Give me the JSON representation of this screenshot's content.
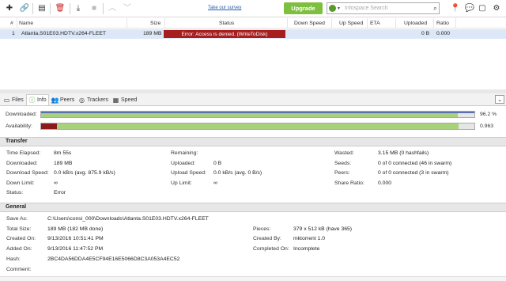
{
  "toolbar": {
    "icons": [
      "add-torrent-icon",
      "add-link-icon",
      "create-torrent-icon",
      "remove-icon",
      "download-icon",
      "stop-icon",
      "move-up-icon",
      "move-down-icon"
    ],
    "survey_label": "Take our survey",
    "upgrade_label": "Upgrade",
    "search_placeholder": "Infospace Search",
    "right_icons": [
      "location-icon",
      "chat-icon",
      "monitor-icon",
      "settings-icon"
    ]
  },
  "columns": {
    "num": "#",
    "name": "Name",
    "size": "Size",
    "status": "Status",
    "down_speed": "Down Speed",
    "up_speed": "Up Speed",
    "eta": "ETA",
    "uploaded": "Uploaded",
    "ratio": "Ratio"
  },
  "torrents": [
    {
      "num": "1",
      "name": "Atlanta.S01E03.HDTV.x264-FLEET",
      "size": "189 MB",
      "status": "Error: Access is denied. (WriteToDisk)",
      "down_speed": "",
      "up_speed": "",
      "eta": "",
      "uploaded": "0 B",
      "ratio": "0.000"
    }
  ],
  "tabs": [
    {
      "label": "Files",
      "icon": "files-icon"
    },
    {
      "label": "Info",
      "icon": "info-icon"
    },
    {
      "label": "Peers",
      "icon": "peers-icon"
    },
    {
      "label": "Trackers",
      "icon": "trackers-icon"
    },
    {
      "label": "Speed",
      "icon": "speed-icon"
    }
  ],
  "downloaded": {
    "label": "Downloaded:",
    "value": "96.2 %",
    "fraction": 0.962
  },
  "availability": {
    "label": "Availability:",
    "value": "0.963",
    "fraction": 0.963
  },
  "transfer": {
    "title": "Transfer",
    "col1": [
      {
        "label": "Time Elapsed:",
        "value": "8m 55s"
      },
      {
        "label": "Downloaded:",
        "value": "189 MB"
      },
      {
        "label": "Download Speed:",
        "value": "0.0 kB/s (avg. 875.9 kB/s)"
      },
      {
        "label": "Down Limit:",
        "value": "∞"
      },
      {
        "label": "Status:",
        "value": "Error"
      }
    ],
    "col2": [
      {
        "label": "Remaining:",
        "value": ""
      },
      {
        "label": "Uploaded:",
        "value": "0 B"
      },
      {
        "label": "Upload Speed:",
        "value": "0.0 kB/s (avg. 0 B/s)"
      },
      {
        "label": "Up Limit:",
        "value": "∞"
      }
    ],
    "col3": [
      {
        "label": "Wasted:",
        "value": "3.15 MB (0 hashfails)"
      },
      {
        "label": "Seeds:",
        "value": "0 of 0 connected (46 in swarm)"
      },
      {
        "label": "Peers:",
        "value": "0 of 0 connected (3 in swarm)"
      },
      {
        "label": "Share Ratio:",
        "value": "0.000"
      }
    ]
  },
  "general": {
    "title": "General",
    "col1": [
      {
        "label": "Save As:",
        "value": "C:\\Users\\consi_000\\Downloads\\Atlanta.S01E03.HDTV.x264-FLEET"
      },
      {
        "label": "Total Size:",
        "value": "189 MB (182 MB done)"
      },
      {
        "label": "Created On:",
        "value": "9/13/2016 10:51:41 PM"
      },
      {
        "label": "Added On:",
        "value": "9/13/2016 11:47:52 PM"
      },
      {
        "label": "Hash:",
        "value": "2BC4DA56DDA4E5CF94E16E5066D8C3A053A4EC52"
      },
      {
        "label": "Comment:",
        "value": ""
      }
    ],
    "col2": [
      {
        "label": "Pieces:",
        "value": "379 x 512 kB (have 365)"
      },
      {
        "label": "Created By:",
        "value": "mktorrent 1.0"
      },
      {
        "label": "Completed On:",
        "value": "Incomplete"
      }
    ]
  },
  "colors": {
    "upgrade": "#7fbf3f",
    "error_red": "#a61e1e",
    "progress_green": "#a7d17a",
    "avail_red": "#8b1a1a",
    "selected_row": "#dce8f8"
  }
}
